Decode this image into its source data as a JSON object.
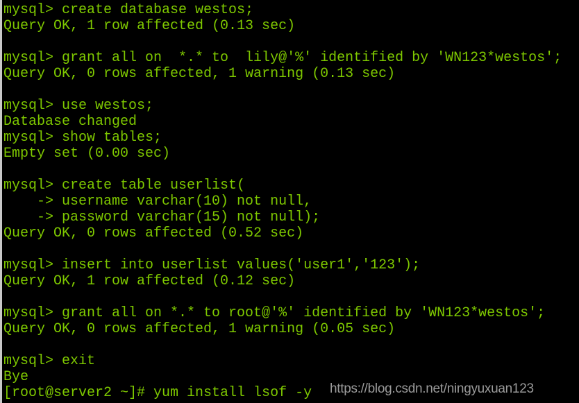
{
  "terminal": {
    "text_color": "#7ec800",
    "background": "#000000",
    "lines": [
      "mysql> create database westos;",
      "Query OK, 1 row affected (0.13 sec)",
      "",
      "mysql> grant all on  *.* to  lily@'%' identified by 'WN123*westos';",
      "Query OK, 0 rows affected, 1 warning (0.13 sec)",
      "",
      "mysql> use westos;",
      "Database changed",
      "mysql> show tables;",
      "Empty set (0.00 sec)",
      "",
      "mysql> create table userlist(",
      "    -> username varchar(10) not null,",
      "    -> password varchar(15) not null);",
      "Query OK, 0 rows affected (0.52 sec)",
      "",
      "mysql> insert into userlist values('user1','123');",
      "Query OK, 1 row affected (0.12 sec)",
      "",
      "mysql> grant all on *.* to root@'%' identified by 'WN123*westos';",
      "Query OK, 0 rows affected, 1 warning (0.05 sec)",
      "",
      "mysql> exit",
      "Bye",
      "[root@server2 ~]# yum install lsof -y"
    ]
  },
  "watermark": "https://blog.csdn.net/ningyuxuan123"
}
